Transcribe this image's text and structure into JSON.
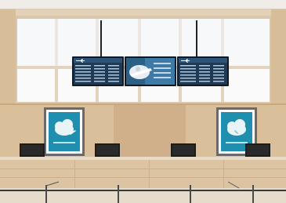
{
  "scene": {
    "description_tags": [
      "airport-check-in-counter",
      "flight-information-displays",
      "wood-paneling",
      "large-windows",
      "queue-stanchions"
    ],
    "colors": {
      "ceiling": "#f2f0ec",
      "window_frame": "#d9c8ae",
      "window_glass": "#fbfbfb",
      "wood_light": "#dcc4a2",
      "wood_mid": "#cfb08a",
      "wood_dark": "#b8966e",
      "poster_teal": "#1f8fb0",
      "poster_frame": "#5a5a5a",
      "screen_dark": "#1a2a3a",
      "floor": "#e2d6c4",
      "monitor": "#1c1c1c"
    }
  },
  "displays": {
    "left_board_icon": "plane-icon",
    "center_board_icon": "plane-graphic-icon",
    "right_board_icon": "plane-icon"
  },
  "posters": {
    "left_icon": "cloud-plane-icon",
    "right_icon": "cloud-plane-icon"
  }
}
